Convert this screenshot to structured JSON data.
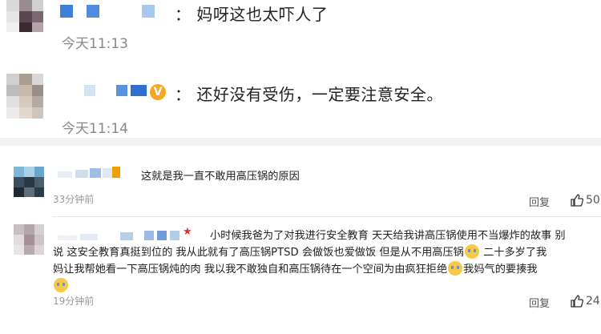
{
  "top_comments": [
    {
      "text": "：  妈呀这也太吓人了",
      "time": "今天11:13"
    },
    {
      "text": "：  还好没有受伤，一定要注意安全。",
      "time": "今天11:14",
      "verified_badge": "V"
    }
  ],
  "weibo_comments": [
    {
      "text": "这就是我一直不敢用高压锅的原因",
      "time": "33分钟前",
      "reply_label": "回复",
      "like_count": "50"
    },
    {
      "lines": [
        "小时候我爸为了对我进行安全教育 天天给我讲高压锅使用不当爆炸的故事 别",
        "说 这安全教育真挺到位的 我从此就有了高压锅PTSD 会做饭也爱做饭 但是从不用高压锅",
        "二十多岁了我",
        "妈让我帮她看一下高压锅炖的肉 我以我不敢独自和高压锅待在一个空间为由疯狂拒绝",
        "我妈气的要揍我"
      ],
      "time": "19分钟前",
      "reply_label": "回复",
      "like_count": "24"
    }
  ],
  "icons": [
    "avatar-mosaic",
    "verified-badge",
    "thumbs-up-icon",
    "crying-emoji",
    "red-star"
  ],
  "colors": {
    "badge": "#f6a623",
    "link": "#555555",
    "emoji": "#f7c948"
  }
}
